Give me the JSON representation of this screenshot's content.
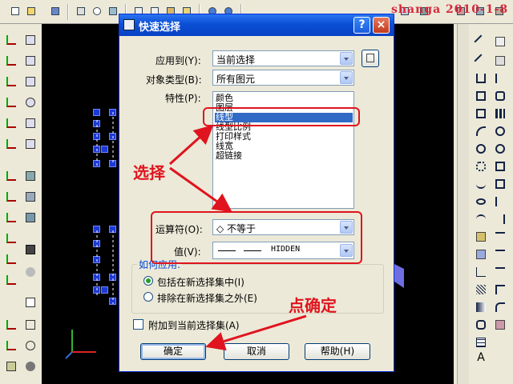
{
  "watermark": "shanga 2010-1-8",
  "dialog": {
    "title": "快速选择",
    "help_label": "?",
    "close_label": "×",
    "apply_to_label": "应用到(Y):",
    "apply_to_value": "当前选择",
    "object_type_label": "对象类型(B):",
    "object_type_value": "所有图元",
    "properties_label": "特性(P):",
    "properties": [
      "颜色",
      "图层",
      "线型",
      "线型比例",
      "打印样式",
      "线宽",
      "超链接"
    ],
    "selected_property": "线型",
    "operator_label": "运算符(O):",
    "operator_value": "◇ 不等于",
    "value_label": "值(V):",
    "value_value": "HIDDEN",
    "how_to_apply_label": "如何应用:",
    "include_option": "包括在新选择集中(I)",
    "exclude_option": "排除在新选择集之外(E)",
    "append_label": "附加到当前选择集(A)",
    "ok_label": "确定",
    "cancel_label": "取消",
    "help_button_label": "帮助(H)"
  },
  "annotations": {
    "select_note": "选择",
    "ok_note": "点确定"
  },
  "colors": {
    "titlebar": "#0a4fd6",
    "selection": "#316ac5",
    "annotation": "#e0141e",
    "drawing_bg": "#000000",
    "entity_blue": "#1d3ad6"
  },
  "icons": {
    "toolbar": [
      "new-icon",
      "open-icon",
      "save-icon",
      "print-icon",
      "preview-icon",
      "publish-icon",
      "cut-icon",
      "copy-icon",
      "paste-icon",
      "match-icon",
      "undo-icon",
      "redo-icon",
      "pan-icon",
      "zoom-icon",
      "zoom-window-icon",
      "zoom-prev-icon",
      "properties-icon",
      "design-center-icon",
      "tool-palette-icon"
    ],
    "left_toolbar": [
      "ucs-icon",
      "ucs-world-icon",
      "ucs-previous-icon",
      "ucs-object-icon",
      "ucs-face-icon",
      "ucs-view-icon",
      "ucs-origin-icon",
      "ucs-zaxis-icon",
      "ucs-3point-icon",
      "ucs-x-icon",
      "ucs-y-icon",
      "ucs-z-icon",
      "ucs-apply-icon",
      "ucs-named-icon",
      "render-icon",
      "camera-icon"
    ],
    "drawing_toolbar": [
      "line-icon",
      "xline-icon",
      "pline-icon",
      "polygon-icon",
      "rectangle-icon",
      "arc-icon",
      "circle-icon",
      "revcloud-icon",
      "spline-icon",
      "ellipse-icon",
      "ellipse-arc-icon",
      "insert-block-icon",
      "make-block-icon",
      "point-icon",
      "hatch-icon",
      "gradient-icon",
      "region-icon",
      "table-icon",
      "mtext-icon"
    ],
    "modify_toolbar": [
      "erase-icon",
      "copy-obj-icon",
      "mirror-icon",
      "offset-icon",
      "array-icon",
      "move-icon",
      "rotate-icon",
      "scale-icon",
      "stretch-icon",
      "trim-icon",
      "extend-icon",
      "break-at-point-icon",
      "break-icon",
      "join-icon",
      "chamfer-icon",
      "fillet-icon",
      "explode-icon"
    ]
  }
}
